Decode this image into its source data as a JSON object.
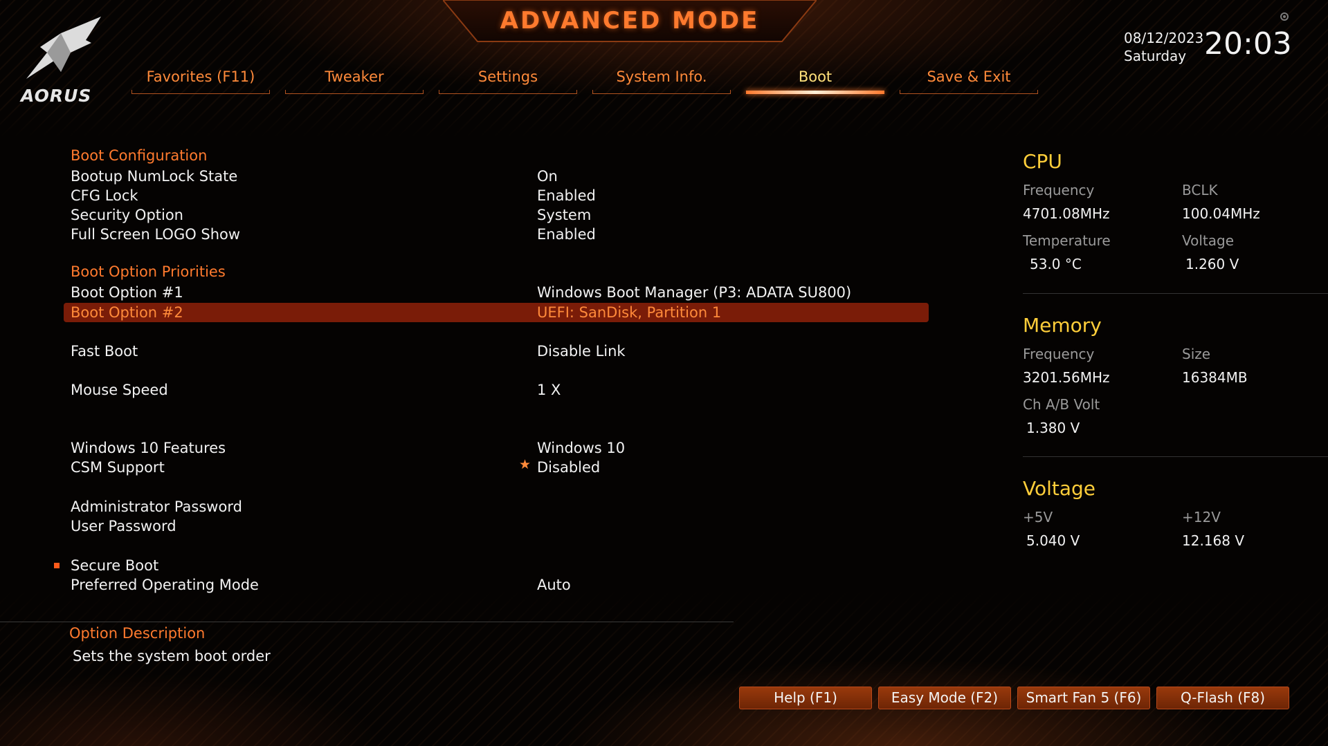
{
  "header": {
    "mode_title": "ADVANCED MODE",
    "logo_text": "AORUS",
    "date": "08/12/2023",
    "day": "Saturday",
    "time": "20:03",
    "accent_color": "#ff7a2e",
    "highlight_color": "#ffce3a"
  },
  "tabs": [
    {
      "label": "Favorites (F11)",
      "active": false
    },
    {
      "label": "Tweaker",
      "active": false
    },
    {
      "label": "Settings",
      "active": false
    },
    {
      "label": "System Info.",
      "active": false
    },
    {
      "label": "Boot",
      "active": true
    },
    {
      "label": "Save & Exit",
      "active": false
    }
  ],
  "boot": {
    "section_config": "Boot Configuration",
    "numlock": {
      "label": "Bootup NumLock State",
      "value": "On"
    },
    "cfg_lock": {
      "label": "CFG Lock",
      "value": "Enabled"
    },
    "security": {
      "label": "Security Option",
      "value": "System"
    },
    "logo_show": {
      "label": "Full Screen LOGO Show",
      "value": "Enabled"
    },
    "section_priorities": "Boot Option Priorities",
    "option1": {
      "label": "Boot Option #1",
      "value": "Windows Boot Manager (P3: ADATA SU800)"
    },
    "option2": {
      "label": "Boot Option #2",
      "value": "UEFI: SanDisk, Partition 1"
    },
    "fast_boot": {
      "label": "Fast Boot",
      "value": "Disable Link"
    },
    "mouse_speed": {
      "label": "Mouse Speed",
      "value": "1 X"
    },
    "win10": {
      "label": "Windows 10 Features",
      "value": "Windows 10"
    },
    "csm": {
      "label": "CSM Support",
      "value": "Disabled"
    },
    "admin_pw": {
      "label": "Administrator Password"
    },
    "user_pw": {
      "label": "User Password"
    },
    "secure_boot": {
      "label": "Secure Boot"
    },
    "pref_mode": {
      "label": "Preferred Operating Mode",
      "value": "Auto"
    }
  },
  "description": {
    "title": "Option Description",
    "text": "Sets the system boot order"
  },
  "panel": {
    "cpu": {
      "title": "CPU",
      "freq_label": "Frequency",
      "freq_value": "4701.08MHz",
      "bclk_label": "BCLK",
      "bclk_value": "100.04MHz",
      "temp_label": "Temperature",
      "temp_value": "53.0 °C",
      "volt_label": "Voltage",
      "volt_value": "1.260 V"
    },
    "memory": {
      "title": "Memory",
      "freq_label": "Frequency",
      "freq_value": "3201.56MHz",
      "size_label": "Size",
      "size_value": "16384MB",
      "chvolt_label": "Ch A/B Volt",
      "chvolt_value": "1.380 V"
    },
    "voltage": {
      "title": "Voltage",
      "v5_label": "+5V",
      "v5_value": "5.040 V",
      "v12_label": "+12V",
      "v12_value": "12.168 V"
    }
  },
  "footer_buttons": [
    {
      "label": "Help (F1)"
    },
    {
      "label": "Easy Mode (F2)"
    },
    {
      "label": "Smart Fan 5 (F6)"
    },
    {
      "label": "Q-Flash (F8)"
    }
  ],
  "icons": {
    "settings": "gear-icon",
    "logo": "aorus-eagle-logo",
    "required": "star-icon"
  }
}
